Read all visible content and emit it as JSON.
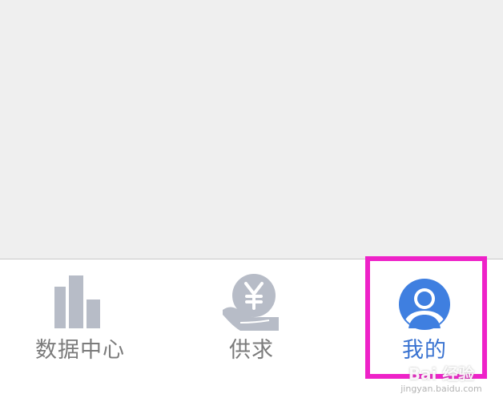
{
  "tabbar": {
    "items": [
      {
        "id": "data-center",
        "label": "数据中心",
        "icon": "bar-chart-icon",
        "active": false
      },
      {
        "id": "supply-demand",
        "label": "供求",
        "icon": "yen-coin-hand-icon",
        "active": false
      },
      {
        "id": "mine",
        "label": "我的",
        "icon": "user-avatar-icon",
        "active": true
      }
    ]
  },
  "colors": {
    "content_background": "#efefef",
    "tabbar_background": "#ffffff",
    "inactive_icon": "#b7bcc7",
    "inactive_label": "#7b7b7b",
    "active": "#3a73d1",
    "highlight_box": "#ee22c8"
  },
  "watermark": {
    "text": "Bai 经验",
    "url": "jingyan.baidu.com"
  }
}
